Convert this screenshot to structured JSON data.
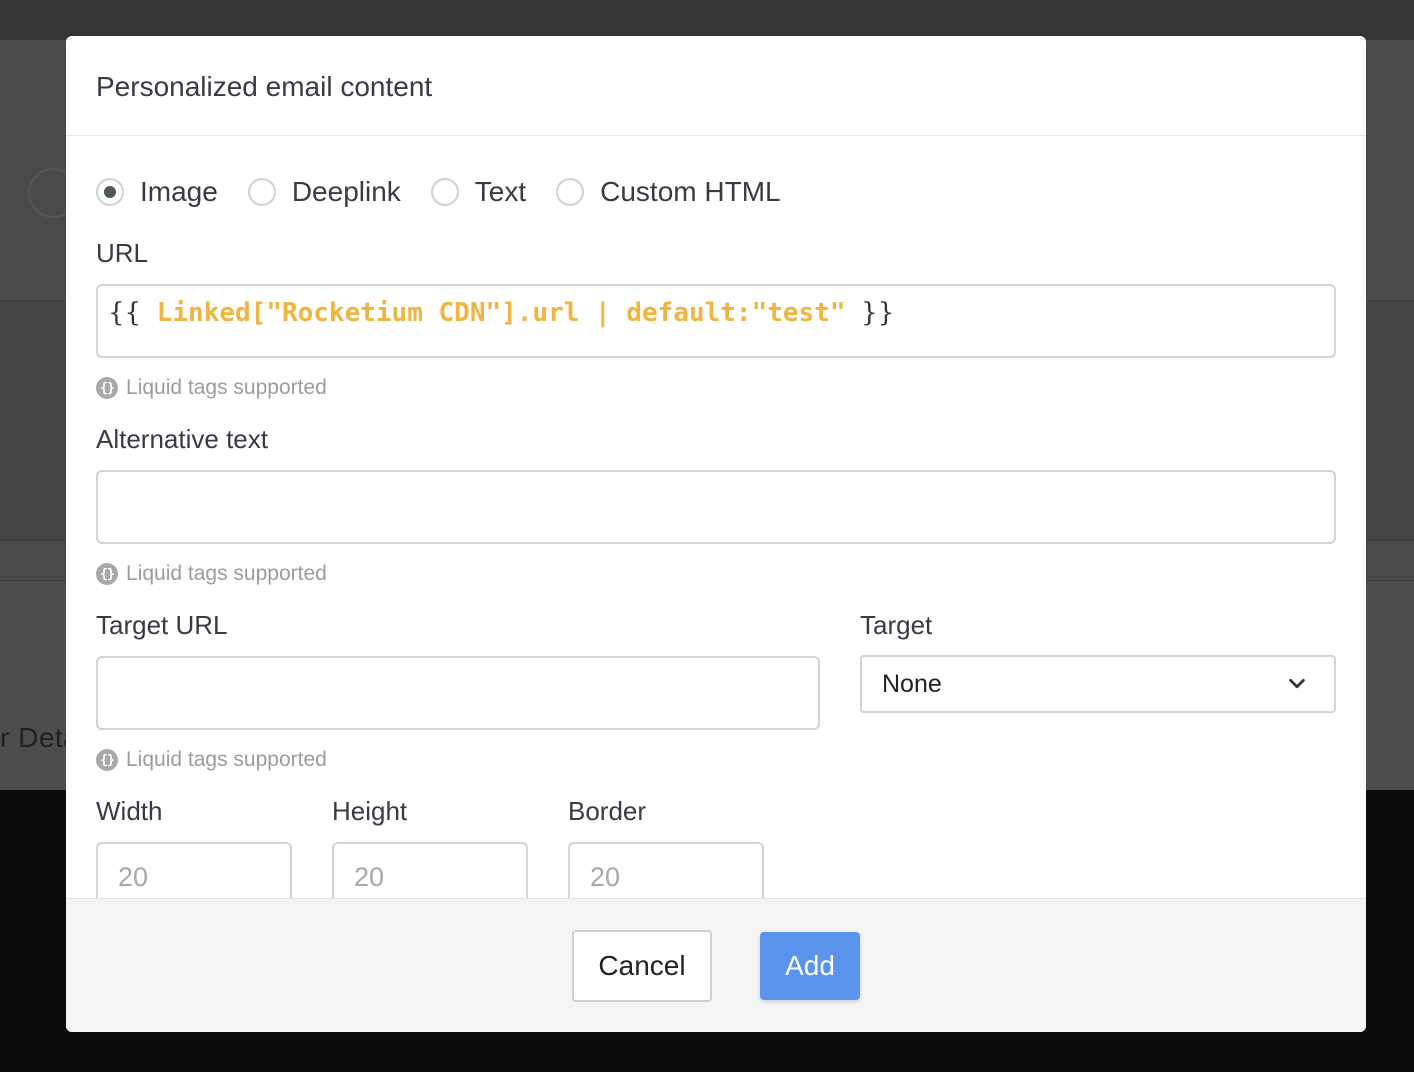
{
  "background": {
    "partial_text": "r Deta"
  },
  "modal": {
    "title": "Personalized email content",
    "content_types": [
      {
        "label": "Image",
        "selected": true
      },
      {
        "label": "Deeplink",
        "selected": false
      },
      {
        "label": "Text",
        "selected": false
      },
      {
        "label": "Custom HTML",
        "selected": false
      }
    ],
    "url": {
      "label": "URL",
      "value_open": "{{",
      "value_expression": "Linked[\"Rocketium CDN\"].url | default:\"test\"",
      "value_close": "}}",
      "hint": "Liquid tags supported"
    },
    "alt_text": {
      "label": "Alternative text",
      "value": "",
      "hint": "Liquid tags supported"
    },
    "target_url": {
      "label": "Target URL",
      "value": "",
      "hint": "Liquid tags supported"
    },
    "target": {
      "label": "Target",
      "selected": "None"
    },
    "width": {
      "label": "Width",
      "placeholder": "20"
    },
    "height": {
      "label": "Height",
      "placeholder": "20"
    },
    "border": {
      "label": "Border",
      "placeholder": "20"
    },
    "buttons": {
      "cancel": "Cancel",
      "add": "Add"
    },
    "hint_icon_glyph": "{}"
  },
  "colors": {
    "primary": "#5b93ec",
    "liquid_code": "#f0b440",
    "overlay": "#4a4a4a"
  },
  "icons": {
    "hint": "liquid-braces-icon",
    "select": "chevron-down-icon"
  }
}
